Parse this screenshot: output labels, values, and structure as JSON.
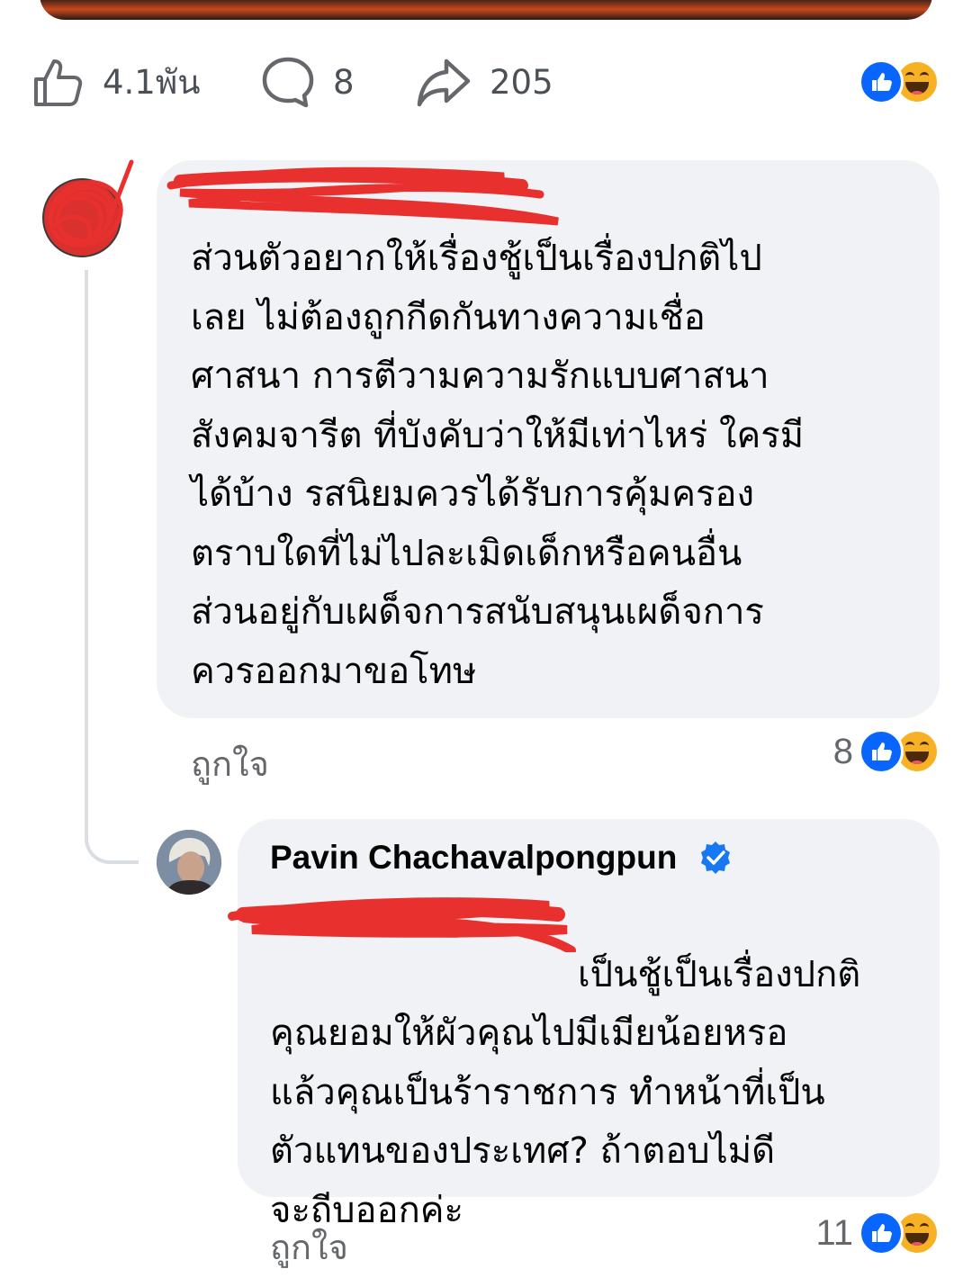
{
  "post_actions": {
    "like_count": "4.1พัน",
    "comment_count": "8",
    "share_count": "205",
    "reactions": [
      "like-icon",
      "haha-icon"
    ]
  },
  "comments": [
    {
      "text": "ส่วนตัวอยากให้เรื่องชู้เป็นเรื่องปกติไป\nเลย ไม่ต้องถูกกีดกันทางความเชื่อ\nศาสนา การตีวามความรักแบบศาสนา\nสังคมจารีต ที่บังคับว่าให้มีเท่าไหร่ ใครมี\nได้บ้าง รสนิยมควรได้รับการคุ้มครอง\nตราบใดที่ไม่ไปละเมิดเด็กหรือคนอื่น\nส่วนอยู่กับเผด็จการสนับสนุนเผด็จการ\nควรออกมาขอโทษ",
      "like_label": "ถูกใจ",
      "reaction_count": "8"
    },
    {
      "author": "Pavin Chachavalpongpun",
      "text": "เป็นชู้เป็นเรื่องปกติ\nคุณยอมให้ผัวคุณไปมีเมียน้อยหรอ\nแล้วคุณเป็นร้าราชการ ทำหน้าที่เป็น\nตัวแทนของประเทศ? ถ้าตอบไม่ดี\nจะถีบออกค่ะ",
      "like_label": "ถูกใจ",
      "reaction_count": "11"
    }
  ],
  "colors": {
    "bubble": "#f0f2f5",
    "secondary_text": "#65676b",
    "like_blue": "#0866ff",
    "haha_yellow": "#f7b125",
    "redaction": "#e8312f"
  }
}
